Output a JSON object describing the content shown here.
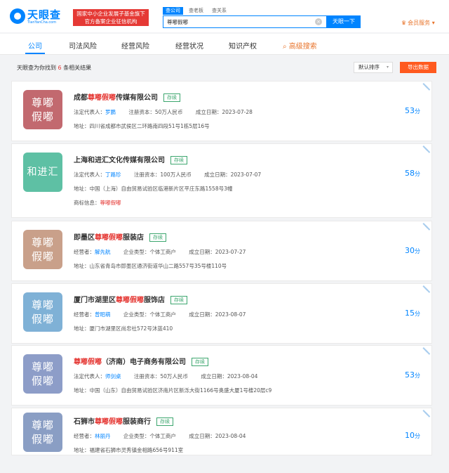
{
  "header": {
    "logo_name": "天眼查",
    "logo_sub": "TianYanCha.com",
    "badge_line1": "国家中小企业发展子基金旗下",
    "badge_line2": "官方备案企业征信机构",
    "search_tabs": [
      "查公司",
      "查老板",
      "查关系"
    ],
    "search_value": "尊嘟假嘟",
    "search_button": "天眼一下",
    "vip_label": "会员服务"
  },
  "nav": {
    "items": [
      "公司",
      "司法风险",
      "经营风险",
      "经营状况",
      "知识产权",
      "高级搜索"
    ]
  },
  "results": {
    "prefix": "天眼查为你找到",
    "count": "6",
    "suffix": "条相关结果",
    "sort_label": "默认排序",
    "export_label": "导出数据"
  },
  "cards": [
    {
      "avatar_line1": "尊嘟",
      "avatar_line2": "假嘟",
      "avatar_color": "#c2696f",
      "name_pre": "成都",
      "name_hl": "尊嘟假嘟",
      "name_post": "传媒有限公司",
      "status": "存续",
      "f1_label": "法定代表人：",
      "f1_value": "罗鹏",
      "f2_label": "注册资本：",
      "f2_value": "50万人民币",
      "f3_label": "成立日期：",
      "f3_value": "2023-07-28",
      "address": "地址：四川省成都市武侯区二环路南四段51号1栋5层16号",
      "score": "53",
      "score_unit": "分"
    },
    {
      "avatar_line1": "和进汇",
      "avatar_line2": "",
      "avatar_color": "#5ec0a4",
      "name_pre": "上海和进汇文化传媒有限公司",
      "name_hl": "",
      "name_post": "",
      "status": "存续",
      "f1_label": "法定代表人：",
      "f1_value": "丁路珍",
      "f2_label": "注册资本：",
      "f2_value": "100万人民币",
      "f3_label": "成立日期：",
      "f3_value": "2023-07-07",
      "address": "地址：中国（上海）自由贸易试验区临港新片区平庄东路1558号3幢",
      "brand_label": "商标信息：",
      "brand_value": "尊嘟假嘟",
      "score": "58",
      "score_unit": "分"
    },
    {
      "avatar_line1": "尊嘟",
      "avatar_line2": "假嘟",
      "avatar_color": "#c9a08a",
      "name_pre": "即墨区",
      "name_hl": "尊嘟假嘟",
      "name_post": "服装店",
      "status": "存续",
      "f1_label": "经营者：",
      "f1_value": "解先航",
      "f2_label": "企业类型：",
      "f2_value": "个体工商户",
      "f3_label": "成立日期：",
      "f3_value": "2023-07-27",
      "address": "地址：山东省青岛市即墨区通济街道华山二路557号35号楼110号",
      "score": "30",
      "score_unit": "分"
    },
    {
      "avatar_line1": "尊嘟",
      "avatar_line2": "假嘟",
      "avatar_color": "#7fb1d6",
      "name_pre": "厦门市湖里区",
      "name_hl": "尊嘟假嘟",
      "name_post": "服饰店",
      "status": "存续",
      "f1_label": "经营者：",
      "f1_value": "曾昭萌",
      "f2_label": "企业类型：",
      "f2_value": "个体工商户",
      "f3_label": "成立日期：",
      "f3_value": "2023-08-07",
      "address": "地址：厦门市湖里区尚忠社572号沐蓝410",
      "score": "15",
      "score_unit": "分"
    },
    {
      "avatar_line1": "尊嘟",
      "avatar_line2": "假嘟",
      "avatar_color": "#8d9dc8",
      "name_pre": "",
      "name_hl": "尊嘟假嘟",
      "name_post": "（济南）电子商务有限公司",
      "status": "存续",
      "f1_label": "法定代表人：",
      "f1_value": "师剑桌",
      "f2_label": "注册资本：",
      "f2_value": "50万人民币",
      "f3_label": "成立日期：",
      "f3_value": "2023-08-04",
      "address": "地址：中国（山东）自由贸易试验区济南片区新泺大街1166号奥盛大厦1号楼20层c9",
      "score": "53",
      "score_unit": "分"
    },
    {
      "avatar_line1": "尊嘟",
      "avatar_line2": "假嘟",
      "avatar_color": "#8a9ec4",
      "name_pre": "石狮市",
      "name_hl": "尊嘟假嘟",
      "name_post": "服装商行",
      "status": "存续",
      "f1_label": "经营者：",
      "f1_value": "林丽丹",
      "f2_label": "企业类型：",
      "f2_value": "个体工商户",
      "f3_label": "成立日期：",
      "f3_value": "2023-08-04",
      "address": "地址：福建省石狮市灵秀镇金相路656号911室",
      "score": "10",
      "score_unit": "分"
    }
  ]
}
